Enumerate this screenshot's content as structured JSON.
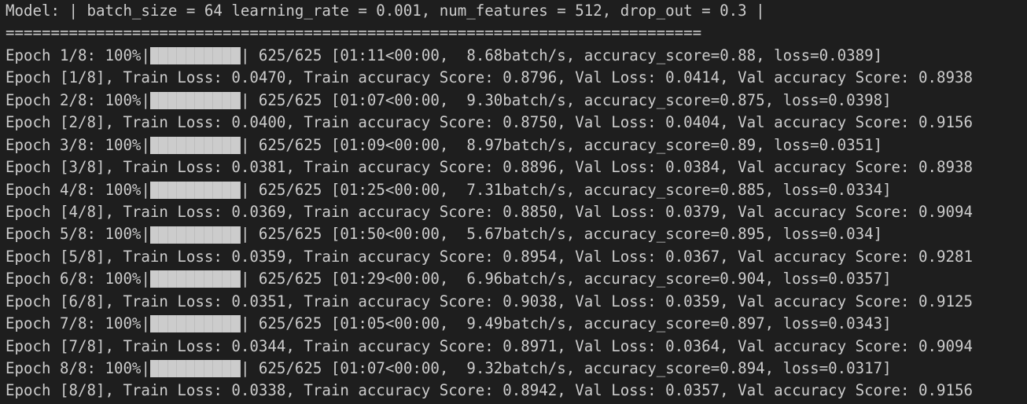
{
  "colors": {
    "background": "#1e1e1e",
    "text": "#cccccc",
    "bar": "#cccccc"
  },
  "header": "Model: | batch_size = 64 learning_rate = 0.001, num_features = 512, drop_out = 0.3 |",
  "separator": "=============================================================================",
  "epochs": [
    {
      "progress": {
        "label": "Epoch 1/8: 100%",
        "bar_fraction": 1.0,
        "tail": "| 625/625 [01:11<00:00,  8.68batch/s, accuracy_score=0.88, loss=0.0389]"
      },
      "summary": "Epoch [1/8], Train Loss: 0.0470, Train accuracy Score: 0.8796, Val Loss: 0.0414, Val accuracy Score: 0.8938"
    },
    {
      "progress": {
        "label": "Epoch 2/8: 100%",
        "bar_fraction": 1.0,
        "tail": "| 625/625 [01:07<00:00,  9.30batch/s, accuracy_score=0.875, loss=0.0398]"
      },
      "summary": "Epoch [2/8], Train Loss: 0.0400, Train accuracy Score: 0.8750, Val Loss: 0.0404, Val accuracy Score: 0.9156"
    },
    {
      "progress": {
        "label": "Epoch 3/8: 100%",
        "bar_fraction": 1.0,
        "tail": "| 625/625 [01:09<00:00,  8.97batch/s, accuracy_score=0.89, loss=0.0351]"
      },
      "summary": "Epoch [3/8], Train Loss: 0.0381, Train accuracy Score: 0.8896, Val Loss: 0.0384, Val accuracy Score: 0.8938"
    },
    {
      "progress": {
        "label": "Epoch 4/8: 100%",
        "bar_fraction": 1.0,
        "tail": "| 625/625 [01:25<00:00,  7.31batch/s, accuracy_score=0.885, loss=0.0334]"
      },
      "summary": "Epoch [4/8], Train Loss: 0.0369, Train accuracy Score: 0.8850, Val Loss: 0.0379, Val accuracy Score: 0.9094"
    },
    {
      "progress": {
        "label": "Epoch 5/8: 100%",
        "bar_fraction": 1.0,
        "tail": "| 625/625 [01:50<00:00,  5.67batch/s, accuracy_score=0.895, loss=0.034]"
      },
      "summary": "Epoch [5/8], Train Loss: 0.0359, Train accuracy Score: 0.8954, Val Loss: 0.0367, Val accuracy Score: 0.9281"
    },
    {
      "progress": {
        "label": "Epoch 6/8: 100%",
        "bar_fraction": 1.0,
        "tail": "| 625/625 [01:29<00:00,  6.96batch/s, accuracy_score=0.904, loss=0.0357]"
      },
      "summary": "Epoch [6/8], Train Loss: 0.0351, Train accuracy Score: 0.9038, Val Loss: 0.0359, Val accuracy Score: 0.9125"
    },
    {
      "progress": {
        "label": "Epoch 7/8: 100%",
        "bar_fraction": 1.0,
        "tail": "| 625/625 [01:05<00:00,  9.49batch/s, accuracy_score=0.897, loss=0.0343]"
      },
      "summary": "Epoch [7/8], Train Loss: 0.0344, Train accuracy Score: 0.8971, Val Loss: 0.0364, Val accuracy Score: 0.9094"
    },
    {
      "progress": {
        "label": "Epoch 8/8: 100%",
        "bar_fraction": 1.0,
        "tail": "| 625/625 [01:07<00:00,  9.32batch/s, accuracy_score=0.894, loss=0.0317]"
      },
      "summary": "Epoch [8/8], Train Loss: 0.0338, Train accuracy Score: 0.8942, Val Loss: 0.0357, Val accuracy Score: 0.9156"
    }
  ]
}
